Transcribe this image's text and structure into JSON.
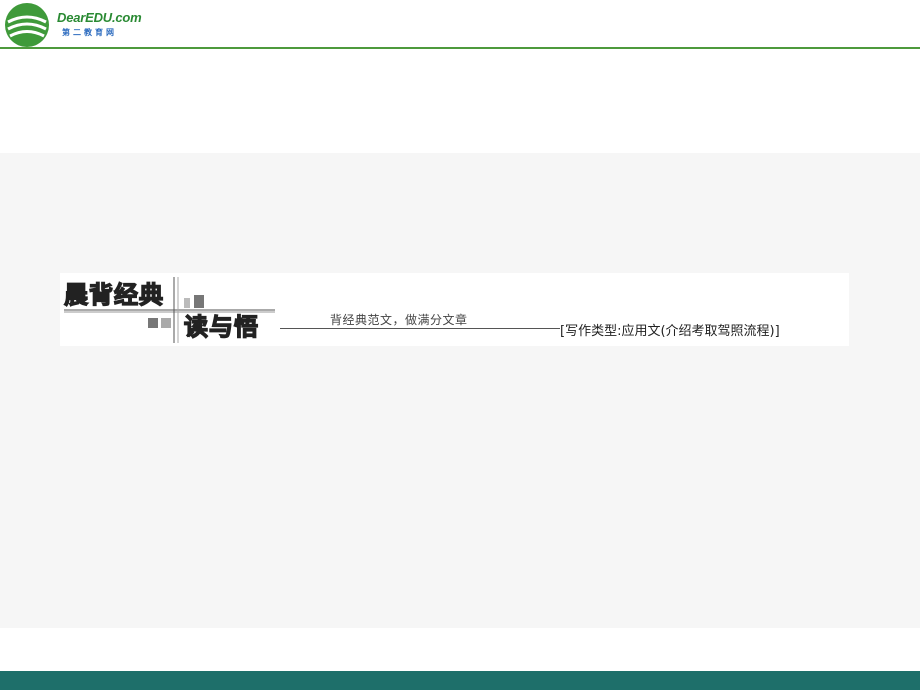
{
  "header": {
    "logo_text": "DearEDU.com",
    "logo_subtext": "第二教育网",
    "logo_icon": "dearedu-logo-icon",
    "rule_color": "#4e9a3c"
  },
  "banner": {
    "title_part1": "晨背经典",
    "title_part2": "读与悟",
    "motto": "背经典范文，做满分文章",
    "genre_tag": "[写作类型:应用文(介绍考取驾照流程)]"
  },
  "colors": {
    "footer_bar": "#1e6f6a",
    "content_background": "#f6f6f6"
  }
}
